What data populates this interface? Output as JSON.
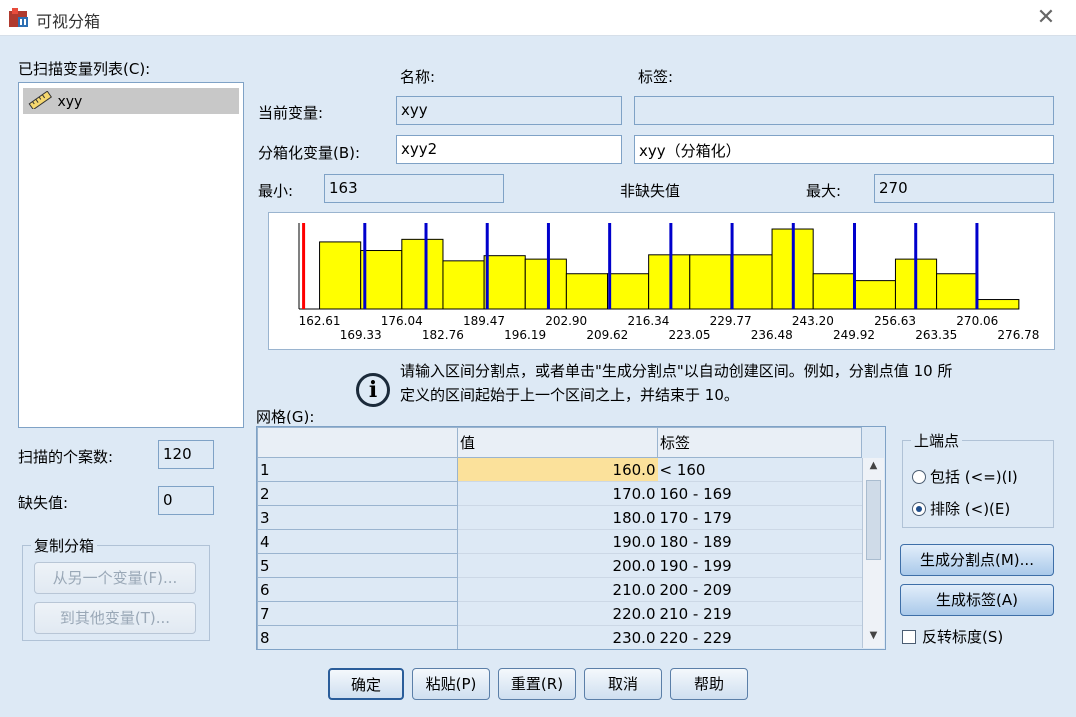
{
  "window": {
    "title": "可视分箱",
    "close_glyph": "✕"
  },
  "scanned_list": {
    "label": "已扫描变量列表(C):",
    "items": [
      {
        "name": "xyy",
        "icon": "ruler-icon"
      }
    ]
  },
  "headers": {
    "name": "名称:",
    "label": "标签:"
  },
  "current_variable": {
    "label": "当前变量:",
    "name": "xyy",
    "var_label": ""
  },
  "binned_variable": {
    "label": "分箱化变量(B):",
    "name": "xyy2",
    "var_label": "xyy（分箱化）"
  },
  "minimum": {
    "label": "最小:",
    "value": "163"
  },
  "nonmissing": {
    "label": "非缺失值"
  },
  "maximum": {
    "label": "最大:",
    "value": "270"
  },
  "chart_data": {
    "type": "bar",
    "x_ticks_row1": [
      "162.61",
      "176.04",
      "189.47",
      "202.90",
      "216.34",
      "229.77",
      "243.20",
      "256.63",
      "270.06"
    ],
    "x_ticks_row2": [
      "169.33",
      "182.76",
      "196.19",
      "209.62",
      "223.05",
      "236.48",
      "249.92",
      "263.35",
      "276.78"
    ],
    "bar_heights": [
      0.78,
      0.68,
      0.81,
      0.56,
      0.62,
      0.58,
      0.41,
      0.41,
      0.63,
      0.63,
      0.63,
      0.93,
      0.41,
      0.33,
      0.58,
      0.41,
      0.11
    ],
    "cutpoints": [
      160,
      170,
      180,
      190,
      200,
      210,
      220,
      230,
      240,
      250,
      260,
      270
    ],
    "x_range": [
      159.25,
      280.14
    ],
    "bar_color": "#ffff00",
    "cutpoint_color": "#0000cc",
    "first_cutpoint_color": "#ff0000"
  },
  "info_text": {
    "icon": "info-icon",
    "line1": "请输入区间分割点，或者单击\"生成分割点\"以自动创建区间。例如，分割点值 10 所",
    "line2": "定义的区间起始于上一个区间之上，并结束于 10。"
  },
  "grid": {
    "label": "网格(G):",
    "columns": [
      "值",
      "标签"
    ],
    "rows": [
      {
        "n": "1",
        "value": "160.0",
        "label": "< 160"
      },
      {
        "n": "2",
        "value": "170.0",
        "label": "160 - 169"
      },
      {
        "n": "3",
        "value": "180.0",
        "label": "170 - 179"
      },
      {
        "n": "4",
        "value": "190.0",
        "label": "180 - 189"
      },
      {
        "n": "5",
        "value": "200.0",
        "label": "190 - 199"
      },
      {
        "n": "6",
        "value": "210.0",
        "label": "200 - 209"
      },
      {
        "n": "7",
        "value": "220.0",
        "label": "210 - 219"
      },
      {
        "n": "8",
        "value": "230.0",
        "label": "220 - 229"
      }
    ]
  },
  "cases_scanned": {
    "label": "扫描的个案数:",
    "value": "120"
  },
  "missing_values": {
    "label": "缺失值:",
    "value": "0"
  },
  "copy_bins": {
    "label": "复制分箱",
    "from_button": "从另一个变量(F)...",
    "to_button": "到其他变量(T)..."
  },
  "upper_endpoints": {
    "label": "上端点",
    "include": "包括 (<=)(I)",
    "exclude": "排除 (<)(E)",
    "selected": "exclude"
  },
  "make_cutpoints": "生成分割点(M)...",
  "make_labels": "生成标签(A)",
  "reverse_scale": "反转标度(S)",
  "footer": {
    "ok": "确定",
    "paste": "粘贴(P)",
    "reset": "重置(R)",
    "cancel": "取消",
    "help": "帮助"
  },
  "colors": {
    "dialog_bg": "#dde9f5",
    "field_border": "#7fa2c6",
    "selection": "#fbe19b"
  }
}
